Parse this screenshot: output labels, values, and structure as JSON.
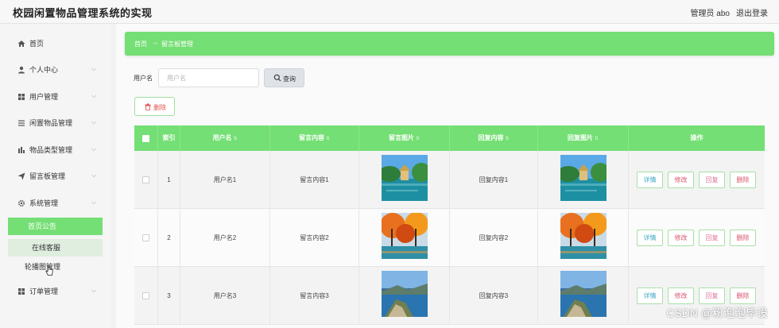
{
  "app": {
    "title": "校园闲置物品管理系统的实现",
    "user_label": "管理员 abo",
    "logout_label": "退出登录"
  },
  "sidebar": {
    "items": [
      {
        "label": "首页",
        "icon": "home-icon",
        "has_arrow": false
      },
      {
        "label": "个人中心",
        "icon": "user-icon",
        "has_arrow": true
      },
      {
        "label": "用户管理",
        "icon": "grid-icon",
        "has_arrow": true
      },
      {
        "label": "闲置物品管理",
        "icon": "list-icon",
        "has_arrow": true
      },
      {
        "label": "物品类型管理",
        "icon": "bar-chart-icon",
        "has_arrow": true
      },
      {
        "label": "留言板管理",
        "icon": "send-icon",
        "has_arrow": true
      },
      {
        "label": "系统管理",
        "icon": "gear-icon",
        "has_arrow": true
      }
    ],
    "system_sub": [
      {
        "label": "首页公告"
      },
      {
        "label": "在线客服"
      },
      {
        "label": "轮播图管理"
      }
    ],
    "orders": {
      "label": "订单管理",
      "icon": "grid-icon"
    }
  },
  "breadcrumb": {
    "home": "首页",
    "arrow": "→",
    "current": "留言板管理"
  },
  "search": {
    "label": "用户名",
    "placeholder": "用户名",
    "button": "查询"
  },
  "toolbar": {
    "delete_label": "删除"
  },
  "table": {
    "columns": [
      "",
      "索引",
      "用户名",
      "留言内容",
      "留言图片",
      "回复内容",
      "回复图片",
      "操作"
    ],
    "rows": [
      {
        "index": "1",
        "username": "用户名1",
        "message": "留言内容1",
        "reply": "回复内容1",
        "image": "pagoda-lake-photo"
      },
      {
        "index": "2",
        "username": "用户名2",
        "message": "留言内容2",
        "reply": "回复内容2",
        "image": "autumn-trees-photo"
      },
      {
        "index": "3",
        "username": "用户名3",
        "message": "留言内容3",
        "reply": "回复内容3",
        "image": "coastal-cliff-photo"
      }
    ],
    "actions": {
      "detail": "详情",
      "edit": "修改",
      "reply": "回复",
      "delete": "删除"
    }
  },
  "watermark": "CSDN @粉泡泡毕设",
  "colors": {
    "accent": "#74df74",
    "background": "#f2f2f2",
    "danger": "#d9546b",
    "info": "#3aa7c0"
  }
}
